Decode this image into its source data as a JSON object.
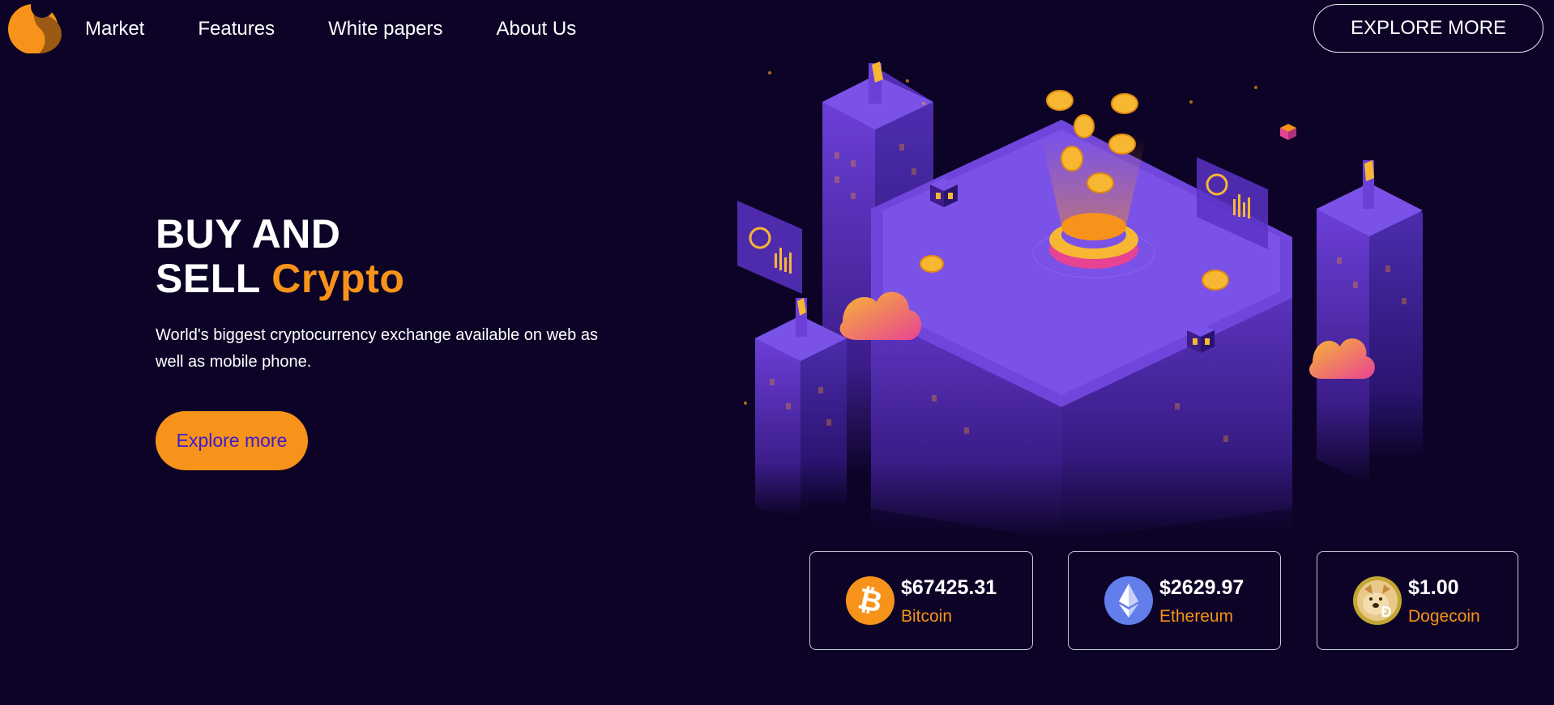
{
  "nav": {
    "logo_icon": "brand-logo-icon",
    "items": [
      {
        "label": "Market"
      },
      {
        "label": "Features"
      },
      {
        "label": "White papers"
      },
      {
        "label": "About Us"
      }
    ],
    "cta_label": "EXPLORE MORE"
  },
  "hero": {
    "title_line1": "BUY AND",
    "title_line2_prefix": "SELL",
    "title_line2_accent": "Crypto",
    "subtitle": "World's biggest cryptocurrency exchange available on web as well as mobile phone.",
    "button_label": "Explore more",
    "illustration_icon": "crypto-city-illustration"
  },
  "coins": [
    {
      "price": "$67425.31",
      "name": "Bitcoin",
      "icon": "bitcoin-icon"
    },
    {
      "price": "$2629.97",
      "name": "Ethereum",
      "icon": "ethereum-icon"
    },
    {
      "price": "$1.00",
      "name": "Dogecoin",
      "icon": "dogecoin-icon"
    }
  ],
  "colors": {
    "background": "#0d0327",
    "accent": "#f7931a",
    "button_text": "#3d1acc",
    "illustration_purple": "#6c3fd8"
  }
}
